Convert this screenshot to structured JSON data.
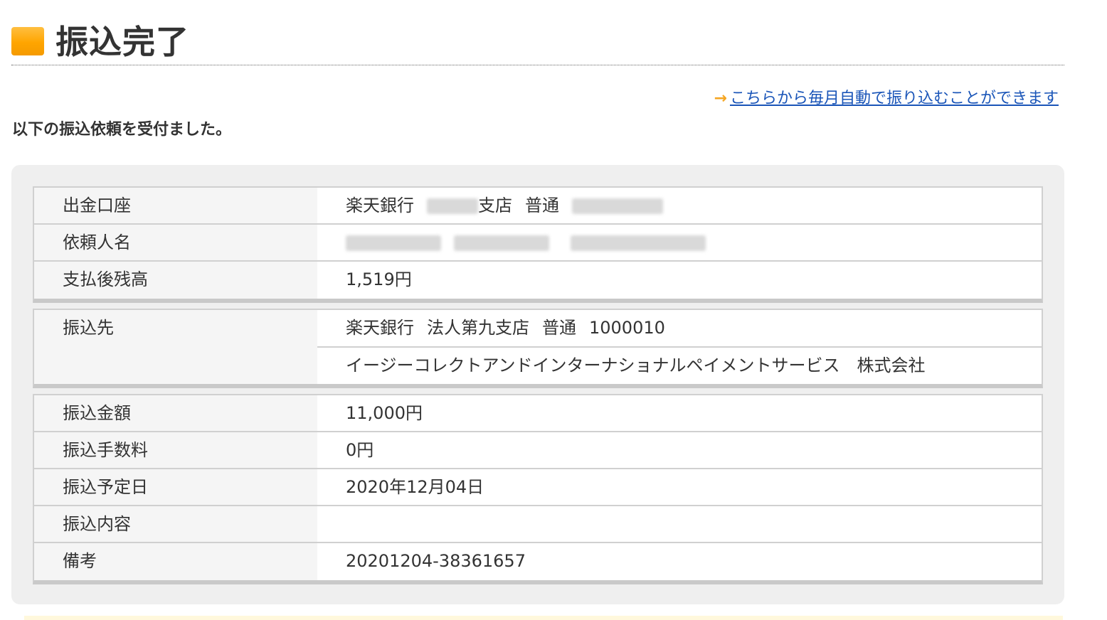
{
  "page": {
    "title": "振込完了",
    "message": "以下の振込依頼を受付ました。",
    "auto_link": {
      "arrow": "→",
      "text": "こちらから毎月自動で振り込むことができます"
    }
  },
  "source": {
    "account_label": "出金口座",
    "bank": "楽天銀行",
    "branch_suffix": "支店",
    "account_type": "普通",
    "requester_label": "依頼人名",
    "balance_label": "支払後残高",
    "balance": "1,519円"
  },
  "destination": {
    "label": "振込先",
    "bank": "楽天銀行",
    "branch": "法人第九支店",
    "account_type": "普通",
    "account_number": "1000010",
    "name": "イージーコレクトアンドインターナショナルペイメントサービス　株式会社"
  },
  "details": {
    "amount_label": "振込金額",
    "amount": "11,000円",
    "fee_label": "振込手数料",
    "fee": "0円",
    "date_label": "振込予定日",
    "date": "2020年12月04日",
    "content_label": "振込内容",
    "content": "",
    "memo_label": "備考",
    "memo": "20201204-38361657"
  },
  "colors": {
    "accent": "#FFA500",
    "link": "#1A55B8",
    "panel_bg": "#EFEFEF",
    "label_bg": "#F5F5F5"
  }
}
